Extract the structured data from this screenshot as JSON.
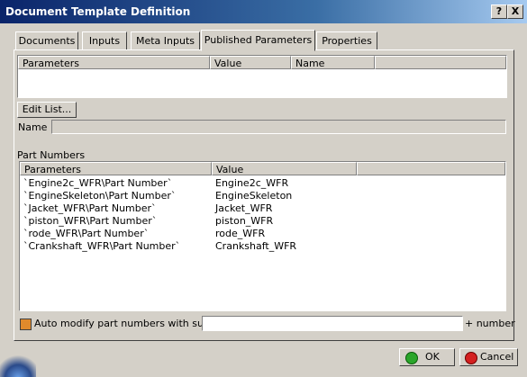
{
  "window": {
    "title": "Document Template Definition",
    "help": "?",
    "close": "X"
  },
  "tabs": [
    {
      "label": "Documents"
    },
    {
      "label": "Inputs"
    },
    {
      "label": "Meta Inputs"
    },
    {
      "label": "Published Parameters"
    },
    {
      "label": "Properties"
    }
  ],
  "published": {
    "columns": [
      "Parameters",
      "Value",
      "Name"
    ],
    "edit_list_label": "Edit List...",
    "name_label": "Name :"
  },
  "part_numbers": {
    "title": "Part Numbers",
    "columns": [
      "Parameters",
      "Value"
    ],
    "rows": [
      {
        "param": "`Engine2c_WFR\\Part Number`",
        "value": "Engine2c_WFR"
      },
      {
        "param": "`EngineSkeleton\\Part Number`",
        "value": "EngineSkeleton"
      },
      {
        "param": "`Jacket_WFR\\Part Number`",
        "value": "Jacket_WFR"
      },
      {
        "param": "`piston_WFR\\Part Number`",
        "value": "piston_WFR"
      },
      {
        "param": "`rode_WFR\\Part Number`",
        "value": "rode_WFR"
      },
      {
        "param": "`Crankshaft_WFR\\Part Number`",
        "value": "Crankshaft_WFR"
      }
    ]
  },
  "auto_modify": {
    "label": "Auto modify part numbers with suffix",
    "suffix_value": "",
    "number_label": "+ number"
  },
  "buttons": {
    "ok": "OK",
    "cancel": "Cancel"
  },
  "colors": {
    "title_start": "#0a246a",
    "ok_icon": "#2aa52a",
    "cancel_icon": "#d42020"
  }
}
